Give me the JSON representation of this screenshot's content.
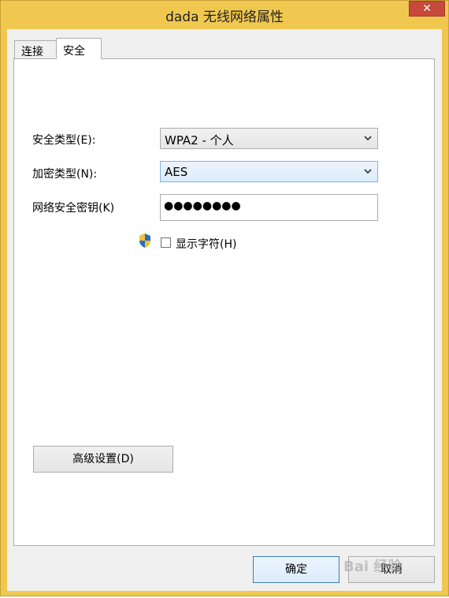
{
  "window": {
    "title": "dada 无线网络属性",
    "close_label": "✕"
  },
  "tabs": [
    {
      "label": "连接"
    },
    {
      "label": "安全"
    }
  ],
  "form": {
    "security_type_label": "安全类型(E):",
    "security_type_value": "WPA2 - 个人",
    "encryption_type_label": "加密类型(N):",
    "encryption_type_value": "AES",
    "network_key_label": "网络安全密钥(K)",
    "network_key_value": "●●●●●●●●",
    "show_chars_label": "显示字符(H)"
  },
  "buttons": {
    "advanced": "高级设置(D)",
    "ok": "确定",
    "cancel": "取消"
  },
  "watermark": "Bai 经验",
  "colors": {
    "titlebar": "#f0c850",
    "close": "#c7493c",
    "focus": "#7eb4ea"
  }
}
